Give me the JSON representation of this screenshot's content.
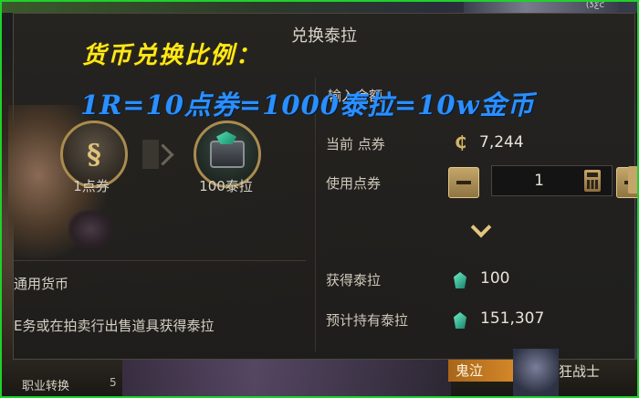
{
  "top_right_text": "(ƾƹƈ",
  "dialog": {
    "title": "兑换泰拉"
  },
  "overlay": {
    "line1": "货币兑换比例：",
    "line2": "1R=10点券=1000泰拉=10w金币"
  },
  "exchange": {
    "from_label": "1点券",
    "to_label": "100泰拉",
    "from_icon": "coupon-coin-icon",
    "to_icon": "tera-gem-chest-icon"
  },
  "left_panel": {
    "currency_title": "通用货币",
    "currency_desc": "E务或在拍卖行出售道具获得泰拉"
  },
  "right_panel": {
    "section_title": "输入金额",
    "current_coupons_label": "当前 点券",
    "current_coupons_value": "7,244",
    "use_coupons_label": "使用点券",
    "use_coupons_value": "1",
    "obtain_tera_label": "获得泰拉",
    "obtain_tera_value": "100",
    "estimated_tera_label": "预计持有泰拉",
    "estimated_tera_value": "151,307"
  },
  "bottom_bar": {
    "job_change": "职业转换",
    "num": "5",
    "tag_guiqi": "鬼泣",
    "tag_kuangzhanshi": "狂战士"
  },
  "colors": {
    "frame_border": "#1fd12a",
    "overlay_yellow": "#ffe81a",
    "overlay_blue": "#2a8fff",
    "gold_accent": "#c4a66a"
  }
}
